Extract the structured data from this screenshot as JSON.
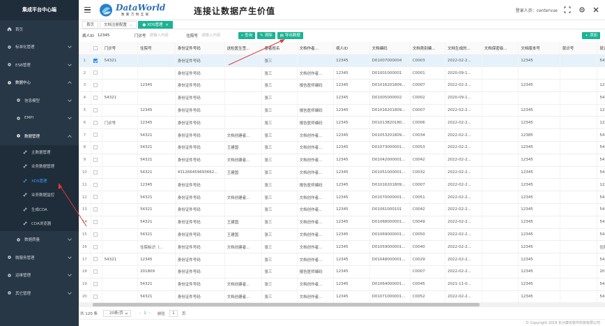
{
  "app": {
    "title": "集成平台中心端"
  },
  "header": {
    "logo_text": "DataWorld",
    "logo_sub": "数 聚 万 物 互 联",
    "slogan": "连接让数据产生价值",
    "user_label": "登录人员：centervue"
  },
  "sidebar": {
    "items": [
      {
        "label": "首页",
        "icon": "home-icon"
      },
      {
        "label": "标准化管理",
        "icon": "gear-icon"
      },
      {
        "label": "ESB管理",
        "icon": "gear-icon"
      },
      {
        "label": "数据中心",
        "icon": "gear-icon"
      },
      {
        "label": "信息模型",
        "icon": "gear-icon"
      },
      {
        "label": "EMPI",
        "icon": "gear-icon"
      },
      {
        "label": "数据管理",
        "icon": "gear-icon"
      },
      {
        "label": "主数据管理",
        "icon": "wrench-icon"
      },
      {
        "label": "业务数据管理",
        "icon": "wrench-icon"
      },
      {
        "label": "XDS管理",
        "icon": "wrench-icon"
      },
      {
        "label": "业务数据监控",
        "icon": "wrench-icon"
      },
      {
        "label": "生成CDA",
        "icon": "wrench-icon"
      },
      {
        "label": "CDA浏览器",
        "icon": "wrench-icon"
      },
      {
        "label": "数据质量",
        "icon": "gear-icon"
      },
      {
        "label": "微服务管理",
        "icon": "gear-icon"
      },
      {
        "label": "运维管理",
        "icon": "gear-icon"
      },
      {
        "label": "其它管理",
        "icon": "gear-icon"
      }
    ]
  },
  "tabs": [
    {
      "label": "首页"
    },
    {
      "label": "文档注册配置"
    },
    {
      "label": "XDS管理"
    }
  ],
  "search": {
    "patient_id_label": "病人ID",
    "patient_id_value": "12345",
    "clinic_label": "门诊号",
    "clinic_placeholder": "请输入内容",
    "inpatient_label": "住院号",
    "inpatient_placeholder": "请输入内容",
    "query_btn": "查询",
    "clear_btn": "清除",
    "export_btn": "导出数据",
    "add_btn": "添加"
  },
  "table": {
    "columns": [
      "",
      "门诊号",
      "住院号",
      "身份证件号码",
      "送检医生签...",
      "患者姓名",
      "文档作者...",
      "病人ID",
      "文档编码",
      "文档类别编...",
      "文档生成的...",
      "文档保密级...",
      "文档版本号",
      "就诊号",
      "就诊流水号",
      "就诊日期时...",
      "消费台"
    ],
    "rows": [
      [
        "1",
        "54321",
        "",
        "身份证件号码",
        "",
        "张三",
        "",
        "12345",
        "D01007000004",
        "C0003",
        "2022-02-2...",
        "",
        "12345",
        "",
        "54321",
        "2018-09-0...",
        ""
      ],
      [
        "2",
        "",
        "",
        "身份证件号码",
        "",
        "张三",
        "文档创作者...",
        "12345",
        "D01001000001",
        "C0001",
        "2020-09-1...",
        "",
        "",
        "",
        "",
        "",
        ""
      ],
      [
        "3",
        "",
        "12345",
        "身份证件号码",
        "",
        "张三",
        "报告医师编码",
        "12345",
        "D01016201809...",
        "C0007",
        "2022-02-2...",
        "",
        "12345",
        "",
        "12345",
        "2018-09-0...",
        ""
      ],
      [
        "4",
        "54321",
        "",
        "身份证件号码",
        "",
        "张三",
        "",
        "12345",
        "D01005000002",
        "C0002",
        "2020-09-1...",
        "",
        "",
        "",
        "54321",
        "2018-09-0...",
        ""
      ],
      [
        "5",
        "",
        "12345",
        "身份证件号码",
        "",
        "张三",
        "报告医师编码",
        "12345",
        "D01016201809...",
        "C0007",
        "2022-02-2...",
        "",
        "12345",
        "",
        "12345",
        "2018-09-1...",
        ""
      ],
      [
        "6",
        "门诊号",
        "12345",
        "身份证件号码",
        "",
        "张三",
        "报告医师编码",
        "12345",
        "D01013820180...",
        "C0006",
        "2022-02-2...",
        "",
        "12345",
        "",
        "12345",
        "2022-02-2...",
        ""
      ],
      [
        "7",
        "",
        "54321",
        "身份证件号码",
        "文档创建者...",
        "张三",
        "文档创作者...",
        "12345",
        "D01053201809...",
        "C0034",
        "2022-02-2...",
        "",
        "12385",
        "",
        "54321",
        "2018-06-1...",
        ""
      ],
      [
        "8",
        "",
        "54321",
        "身份证件号码",
        "王建国",
        "张三",
        "文档创作者...",
        "12345",
        "D01073000001...",
        "C0053",
        "2022-02-2...",
        "",
        "12345",
        "",
        "54321",
        "2018-09-1...",
        ""
      ],
      [
        "9",
        "",
        "54321",
        "身份证件号码",
        "文档创建者...",
        "张三",
        "文档创作者...",
        "12345",
        "D01042000001...",
        "C0042",
        "2022-02-2...",
        "",
        "12345",
        "",
        "54321",
        "2018-09-1...",
        ""
      ],
      [
        "10",
        "",
        "54321",
        "431266459693662...",
        "王建国",
        "张三",
        "文档创作者...",
        "12345",
        "D01051000001...",
        "C0032",
        "2022-02-2...",
        "",
        "12345",
        "",
        "54321",
        "2018-09-0...",
        ""
      ],
      [
        "11",
        "",
        "12345",
        "身份证件号码",
        "",
        "张三",
        "报告医师编码",
        "12345",
        "D01016201809...",
        "C0007",
        "2022-02-2...",
        "",
        "12345",
        "",
        "12345",
        "2018-09-1...",
        ""
      ],
      [
        "12",
        "",
        "54321",
        "身份证件号码",
        "文档创建者...",
        "张三",
        "文档创作者...",
        "12345",
        "D01070000001...",
        "C0051",
        "2022-02-2...",
        "",
        "12345",
        "",
        "54321",
        "2018-09-1...",
        ""
      ],
      [
        "13",
        "",
        "54321",
        "身份证件号码",
        "",
        "张三",
        "文档创作者...",
        "12345",
        "D01061000101",
        "C0042",
        "2022-02-2...",
        "",
        "12345",
        "",
        "54321",
        "2011-11-1...",
        ""
      ],
      [
        "14",
        "",
        "54321",
        "身份证件号码",
        "王建国",
        "张三",
        "文档创作者...",
        "12345",
        "D01068000001...",
        "C0049",
        "2022-02-2...",
        "",
        "12345",
        "",
        "54321",
        "2018-09-1...",
        ""
      ],
      [
        "15",
        "",
        "54321",
        "身份证件号码",
        "王建国",
        "张三",
        "文档创作者...",
        "12345",
        "D01069000001...",
        "C0050",
        "2022-02-2...",
        "",
        "12345",
        "",
        "54321",
        "2018-09-1...",
        ""
      ],
      [
        "16",
        "",
        "住院标识（...",
        "身份证件号码",
        "文档创建者...",
        "张三",
        "文档创作者...",
        "12345",
        "D01059000001...",
        "C0040",
        "2022-02-2...",
        "",
        "12345",
        "",
        "住院标识（病...",
        "2018-09-0...",
        ""
      ],
      [
        "17",
        "54321",
        "12345",
        "身份证件号码",
        "",
        "张三",
        "文档创作者...",
        "12345",
        "D01048000001...",
        "C0029",
        "2022-02-2...",
        "",
        "12345",
        "",
        "54321",
        "2018-09-1...",
        ""
      ],
      [
        "18",
        "",
        "201809",
        "身份证件号码",
        "",
        "张三",
        "报告医师编码",
        "12345",
        "",
        "C0007",
        "2022-02-2...",
        "",
        "12345",
        "",
        "201809",
        "2018-09-1...",
        ""
      ],
      [
        "19",
        "",
        "54321",
        "身份证件号码",
        "文档创建者...",
        "张三",
        "文档创作者...",
        "12345",
        "D01064000001...",
        "C0045",
        "2021-11-0...",
        "",
        "12345",
        "",
        "54321",
        "2018-07-1...",
        ""
      ],
      [
        "20",
        "",
        "54321",
        "身份证件号码",
        "文档创建者...",
        "张三",
        "文档创作者...",
        "12345",
        "D01071000001...",
        "C0052",
        "2022-02-2...",
        "",
        "12345",
        "",
        "54321",
        "2018-09-1...",
        ""
      ]
    ]
  },
  "pager": {
    "total": "共 120 条",
    "page_size": "20条/页",
    "goto_label": "前往",
    "page": "1",
    "page_suffix": "页"
  },
  "footer": {
    "copyright": "© Copyright 2018 长沙康氏软件科技有限公司"
  },
  "colors": {
    "accent": "#1ab394",
    "sidebar": "#283745",
    "annotation": "#e53935",
    "selected": "#2d8cf0"
  }
}
